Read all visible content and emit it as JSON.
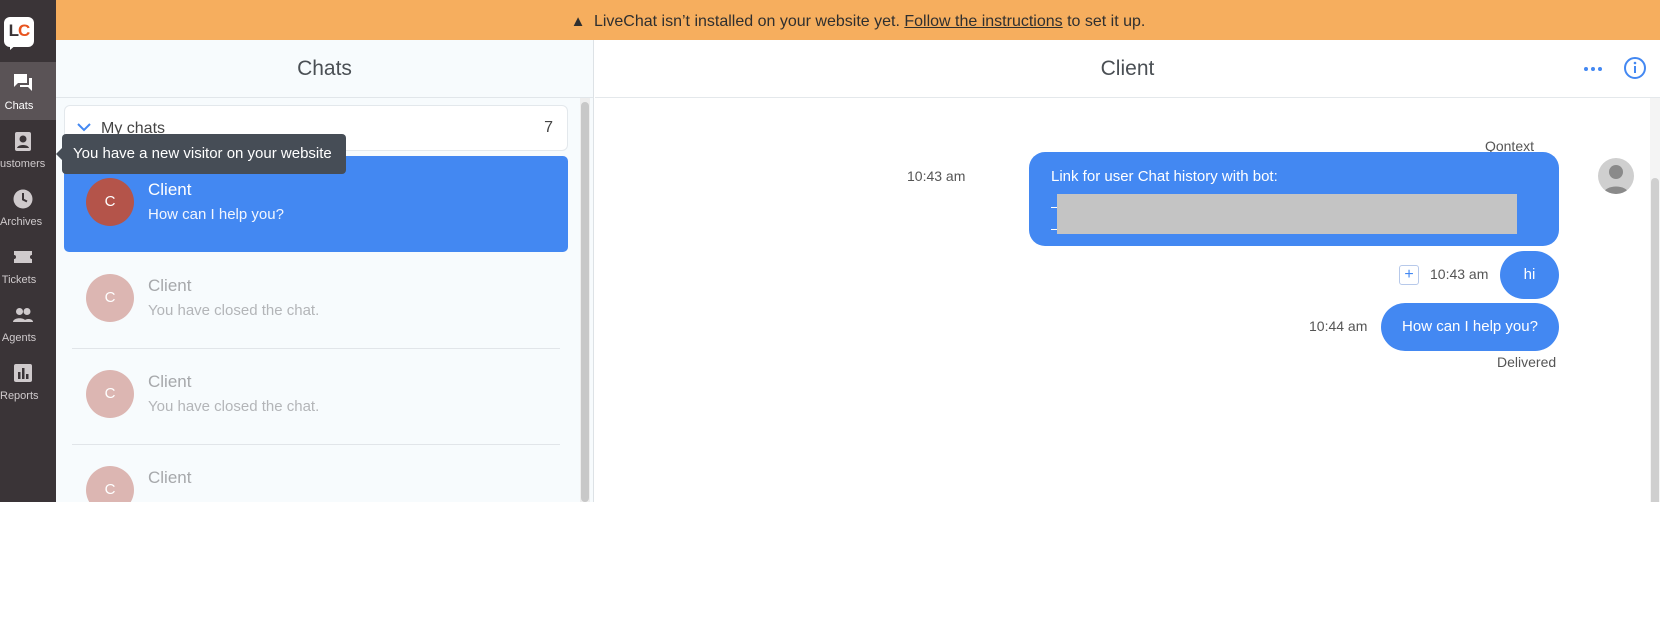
{
  "rail": {
    "logo_l": "L",
    "logo_c": "C",
    "items": [
      {
        "label": "Chats",
        "icon": "chats-icon"
      },
      {
        "label": "ustomers",
        "icon": "customers-icon"
      },
      {
        "label": "Archives",
        "icon": "archives-icon"
      },
      {
        "label": "Tickets",
        "icon": "tickets-icon"
      },
      {
        "label": "Agents",
        "icon": "agents-icon"
      },
      {
        "label": "Reports",
        "icon": "reports-icon"
      }
    ]
  },
  "banner": {
    "icon": "warning-icon",
    "text_before": "LiveChat isn’t installed on your website yet.",
    "link": "Follow the instructions",
    "text_after": "to set it up.",
    "color": "#f6ae5e"
  },
  "chats": {
    "title": "Chats",
    "group_title": "My chats",
    "group_count": "7",
    "tooltip": "You have a new visitor on your website",
    "items": [
      {
        "initial": "C",
        "name": "Client",
        "message": "How can I help you?"
      },
      {
        "initial": "C",
        "name": "Client",
        "message": "You have closed the chat."
      },
      {
        "initial": "C",
        "name": "Client",
        "message": "You have closed the chat."
      },
      {
        "initial": "C",
        "name": "Client",
        "message": ""
      }
    ]
  },
  "conversation": {
    "title": "Client",
    "sender": "Qontext",
    "messages": [
      {
        "time": "10:43 am",
        "text": "Link for user Chat history with bot:"
      },
      {
        "time": "10:43 am",
        "text": "hi"
      },
      {
        "time": "10:44 am",
        "text": "How can I help you?"
      }
    ],
    "status": "Delivered",
    "accent": "#4388f2"
  }
}
